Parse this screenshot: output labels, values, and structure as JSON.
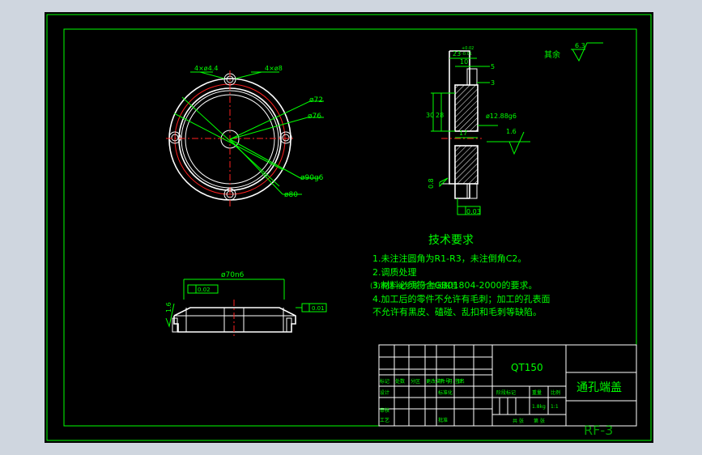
{
  "dims": {
    "d1": "4×ø4.4",
    "d2": "4×ø8",
    "d3": "ø72",
    "d4": "ø76",
    "d5": "ø90g6",
    "d6": "ø80",
    "s1": "23",
    "s1_tol_up": "+0.02",
    "s1_tol_dn": "-0.01",
    "s2": "10",
    "s3": "5",
    "s4": "3",
    "s5": "30",
    "s6": "28",
    "s7": "17",
    "s8": "ø12.88g6",
    "rough1": "1.6",
    "rough2": "0.8",
    "rough3": "1.6",
    "tol_frame": "0.03",
    "bot_dim": "ø70n6",
    "bot_tol": "0.02",
    "bot_tol2": "0.01"
  },
  "roughness_note": {
    "label": "其余",
    "value": "6.3"
  },
  "tech": {
    "title": "技术要求",
    "line1": "1.未注注圆角为R1-R3，未注倒角C2。",
    "line2": "2.调质处理",
    "line3a": "(3)铸造 化学成分 检验报告",
    "line3b": "3.材料必须符合GB01804-2000的要求。",
    "line4": "4.加工后的零件不允许有毛刺；加工的孔表面",
    "line5": "不允许有黑皮、磕碰、乱扣和毛刺等缺陷。"
  },
  "title_block": {
    "material": "QT150",
    "part_name": "通孔端盖",
    "drawing_no": "RF-3",
    "small": {
      "c1": "标记",
      "c2": "处数",
      "c3": "分区",
      "c4": "更改文件号",
      "c5": "签名",
      "c6": "年、月、日",
      "r2c1": "设计",
      "r2c2": "标准化",
      "r3c1": "审核",
      "r4c1": "工艺",
      "r4c3": "批准",
      "stage": "阶段标记",
      "weight": "重量",
      "scale": "比例",
      "weight_val": "1.8kg",
      "scale_val": "1:1",
      "sheets": "共 张",
      "sheet": "第 张"
    }
  }
}
